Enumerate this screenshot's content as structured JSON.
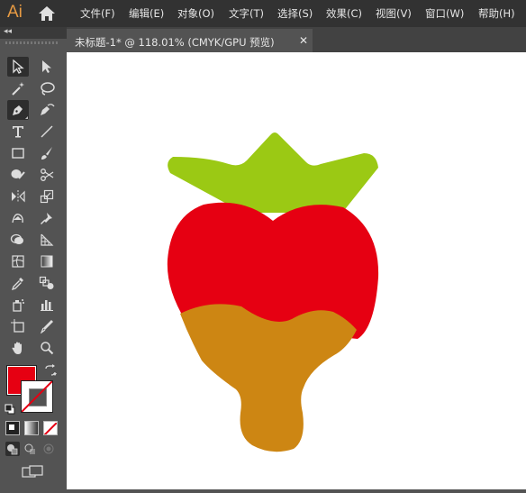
{
  "app": {
    "logo": "Ai"
  },
  "menu": {
    "items": [
      {
        "label": "文件(F)"
      },
      {
        "label": "编辑(E)"
      },
      {
        "label": "对象(O)"
      },
      {
        "label": "文字(T)"
      },
      {
        "label": "选择(S)"
      },
      {
        "label": "效果(C)"
      },
      {
        "label": "视图(V)"
      },
      {
        "label": "窗口(W)"
      },
      {
        "label": "帮助(H)"
      }
    ]
  },
  "document": {
    "tab_title": "未标题-1* @ 118.01% (CMYK/GPU 预览)",
    "close": "✕"
  },
  "toolbar": {
    "collapse": "◂◂"
  },
  "colors": {
    "fill": "#e60012",
    "stroke": "none",
    "leaf": "#9bc914",
    "berry": "#e60012",
    "chocolate": "#cd8613",
    "app_accent": "#e89b43"
  },
  "icons": [
    "home-icon",
    "selection-tool-icon",
    "direct-selection-tool-icon",
    "magic-wand-icon",
    "lasso-icon",
    "pen-tool-icon",
    "curvature-icon",
    "type-tool-icon",
    "line-tool-icon",
    "rectangle-tool-icon",
    "paintbrush-icon",
    "shaper-icon",
    "scissors-icon",
    "reflect-icon",
    "scale-icon",
    "warp-icon",
    "puppet-warp-icon",
    "shape-builder-icon",
    "perspective-grid-icon",
    "mesh-icon",
    "gradient-icon",
    "eyedropper-icon",
    "blend-icon",
    "symbol-sprayer-icon",
    "column-graph-icon",
    "artboard-icon",
    "slice-icon",
    "hand-icon",
    "zoom-icon",
    "swap-colors-icon",
    "default-colors-icon",
    "color-mode-icon",
    "gradient-mode-icon",
    "none-mode-icon",
    "draw-normal-icon",
    "draw-behind-icon",
    "draw-inside-icon",
    "screen-mode-icon"
  ]
}
